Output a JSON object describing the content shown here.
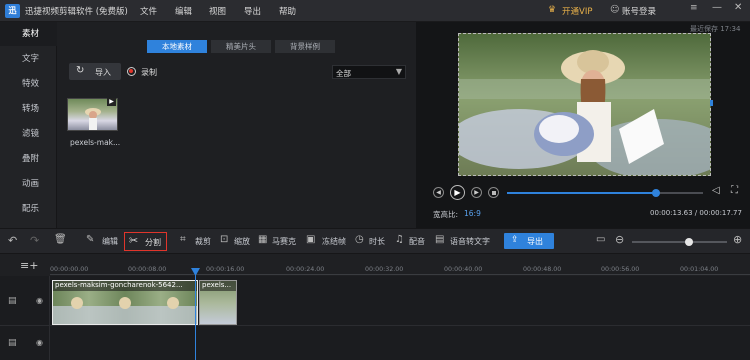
{
  "app": {
    "title": "迅捷视频剪辑软件 (免费版)",
    "logo_text": "迅"
  },
  "menu": [
    "文件",
    "编辑",
    "视图",
    "导出",
    "帮助"
  ],
  "account": {
    "vip": "开通VIP",
    "login": "账号登录"
  },
  "autosave": "最近保存 17:34",
  "sidebar": [
    "素材",
    "文字",
    "特效",
    "转场",
    "滤镜",
    "叠附",
    "动画",
    "配乐"
  ],
  "library": {
    "tabs": [
      "本地素材",
      "精美片头",
      "背景样例"
    ],
    "import_label": "导入",
    "record_label": "录制",
    "filter_value": "全部",
    "clip_name": "pexels-mak..."
  },
  "preview": {
    "aspect_label": "宽高比:",
    "aspect_value": "16:9",
    "time_current": "00:00:13.63",
    "time_total": "00:00:17.77",
    "progress": 0.76
  },
  "toolbar": {
    "edit": "编辑",
    "split": "分割",
    "crop": "裁剪",
    "zoom": "缩放",
    "mosaic": "马赛克",
    "freeze": "冻结帧",
    "duration": "时长",
    "dub": "配音",
    "tts": "语音转文字",
    "export": "导出",
    "zoom_level": 0.6
  },
  "ruler": [
    "00:00:00.00",
    "00:00:08.00",
    "00:00:16.00",
    "00:00:24.00",
    "00:00:32.00",
    "00:00:40.00",
    "00:00:48.00",
    "00:00:56.00",
    "00:01:04.00"
  ],
  "timeline": {
    "clip1": "pexels-maksim-goncharenok-5642...",
    "clip2": "pexels..."
  },
  "colors": {
    "accent": "#2f82dc",
    "highlight": "#e0352b",
    "vip": "#e8b14a"
  }
}
